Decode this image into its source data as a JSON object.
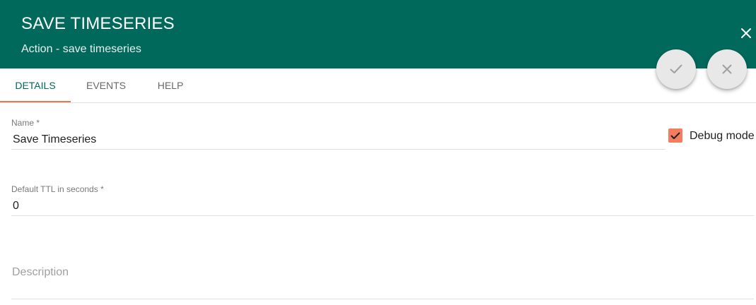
{
  "header": {
    "title": "SAVE TIMESERIES",
    "subtitle": "Action - save timeseries",
    "close_icon": "close-icon",
    "background_color": "#00695c"
  },
  "actions": {
    "apply_icon": "check-icon",
    "cancel_icon": "close-icon"
  },
  "tabs": [
    {
      "label": "DETAILS",
      "active": true
    },
    {
      "label": "EVENTS",
      "active": false
    },
    {
      "label": "HELP",
      "active": false
    }
  ],
  "accent_color": "#ee7450",
  "form": {
    "name": {
      "label": "Name *",
      "value": "Save Timeseries"
    },
    "debug_mode": {
      "label": "Debug mode",
      "checked": true
    },
    "ttl": {
      "label": "Default TTL in seconds *",
      "value": "0"
    },
    "description": {
      "placeholder": "Description",
      "value": ""
    }
  }
}
